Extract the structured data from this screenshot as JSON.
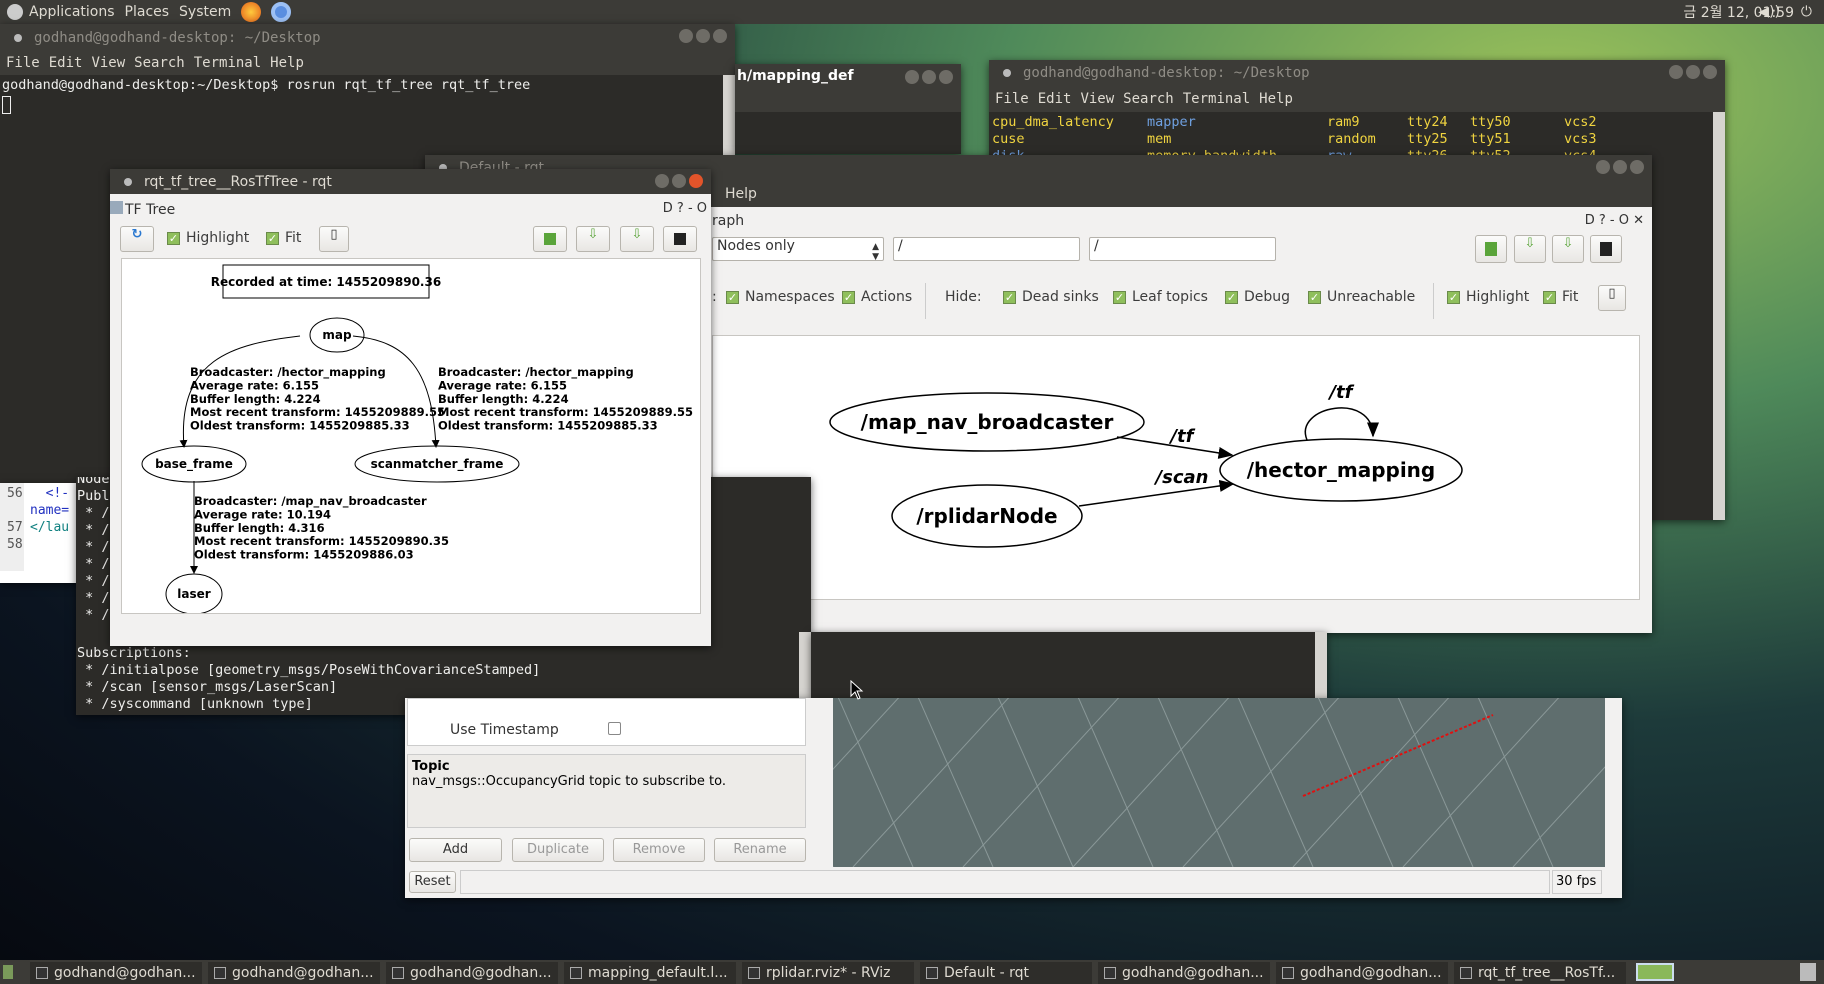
{
  "top_panel": {
    "menus": [
      "Applications",
      "Places",
      "System"
    ],
    "clock": "금 2월 12, 01:59",
    "icons": [
      "ubuntu-logo-icon",
      "firefox-icon",
      "chromium-icon",
      "volume-icon",
      "power-icon"
    ]
  },
  "terminal1": {
    "title": "godhand@godhand-desktop: ~/Desktop",
    "menu": [
      "File",
      "Edit",
      "View",
      "Search",
      "Terminal",
      "Help"
    ],
    "prompt": "godhand@godhand-desktop:~/Desktop$ rosrun rqt_tf_tree rqt_tf_tree"
  },
  "editor_behind": {
    "title": "h/mapping_def",
    "lines": [
      {
        "num": "56",
        "text": "  <!-"
      },
      {
        "num": "",
        "text": "name="
      },
      {
        "num": "57",
        "text": "</lau"
      },
      {
        "num": "58",
        "text": ""
      }
    ]
  },
  "terminal2": {
    "title": "godhand@godhand-desktop: ~/Desktop",
    "menu": [
      "File",
      "Edit",
      "View",
      "Search",
      "Terminal",
      "Help"
    ],
    "rows": [
      [
        "cpu_dma_latency",
        "mapper",
        "ram9",
        "tty24",
        "tty50",
        "vcs2"
      ],
      [
        "cuse",
        "mem",
        "random",
        "tty25",
        "tty51",
        "vcs3"
      ],
      [
        "disk",
        "memory_bandwidth",
        "raw",
        "tty26",
        "tty52",
        "vcs4"
      ]
    ]
  },
  "terminal3": {
    "partial": [
      "Node",
      "Publ",
      " * /",
      " * /",
      " * /",
      " * /",
      " * /",
      " * /",
      " * /"
    ],
    "lines": [
      "Subscriptions:",
      " * /initialpose [geometry_msgs/PoseWithCovarianceStamped]",
      " * /scan [sensor_msgs/LaserScan]",
      " * /syscommand [unknown type]"
    ]
  },
  "rqt_default": {
    "title": "Default - rqt",
    "menu_help": "Help",
    "plugin_title": "raph",
    "plugin_controls": "D ? - O ✕",
    "combo": "Nodes only",
    "filter1": "/",
    "filter2": "/",
    "group_label": ":",
    "checks1": [
      "Namespaces",
      "Actions"
    ],
    "hide_label": "Hide:",
    "checks2": [
      "Dead sinks",
      "Leaf topics",
      "Debug",
      "Unreachable"
    ],
    "checks3": [
      "Highlight",
      "Fit"
    ],
    "graph": {
      "nodes": [
        "/map_nav_broadcaster",
        "/hector_mapping",
        "/rplidarNode"
      ],
      "edges": [
        {
          "from": "/map_nav_broadcaster",
          "to": "/hector_mapping",
          "label": "/tf"
        },
        {
          "from": "/rplidarNode",
          "to": "/hector_mapping",
          "label": "/scan"
        },
        {
          "from": "/hector_mapping",
          "to": "/hector_mapping",
          "label": "/tf"
        }
      ]
    }
  },
  "tf_tree": {
    "title": "rqt_tf_tree__RosTfTree - rqt",
    "plugin_title": "TF Tree",
    "plugin_controls": "D ? - O",
    "checks": [
      "Highlight",
      "Fit"
    ],
    "recorded": "Recorded at time: 1455209890.36",
    "frames": [
      "map",
      "base_frame",
      "scanmatcher_frame",
      "laser"
    ],
    "edge_info": [
      [
        "Broadcaster: /hector_mapping",
        "Average rate: 6.155",
        "Buffer length: 4.224",
        "Most recent transform: 1455209889.55",
        "Oldest transform: 1455209885.33"
      ],
      [
        "Broadcaster: /hector_mapping",
        "Average rate: 6.155",
        "Buffer length: 4.224",
        "Most recent transform: 1455209889.55",
        "Oldest transform: 1455209885.33"
      ],
      [
        "Broadcaster: /map_nav_broadcaster",
        "Average rate: 10.194",
        "Buffer length: 4.316",
        "Most recent transform: 1455209890.35",
        "Oldest transform: 1455209886.03"
      ]
    ]
  },
  "rviz": {
    "property": "Use Timestamp",
    "use_timestamp": false,
    "topic_title": "Topic",
    "topic_desc": "nav_msgs::OccupancyGrid topic to subscribe to.",
    "buttons": [
      "Add",
      "Duplicate",
      "Remove",
      "Rename"
    ],
    "reset": "Reset",
    "fps": "30 fps",
    "grid_color": "#5f6e6e",
    "scan_color": "#e01010"
  },
  "taskbar": [
    "godhand@godhan...",
    "godhand@godhan...",
    "godhand@godhan...",
    "mapping_default.l...",
    "rplidar.rviz* - RViz",
    "Default - rqt",
    "godhand@godhan...",
    "godhand@godhan...",
    "rqt_tf_tree__RosTf..."
  ]
}
